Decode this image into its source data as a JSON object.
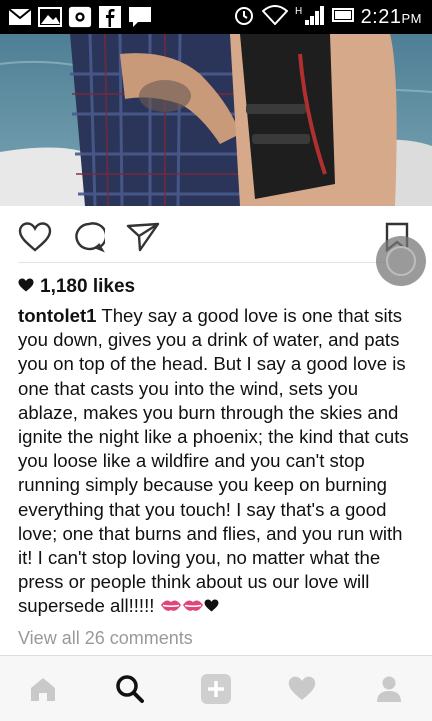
{
  "status_bar": {
    "time": "2:21",
    "ampm": "PM",
    "notification_icons": [
      "mail-icon",
      "gallery-icon",
      "instagram-icon",
      "facebook-icon",
      "message-icon"
    ],
    "system_icons": [
      "alarm-icon",
      "wifi-icon",
      "h-signal-icon",
      "battery-icon"
    ]
  },
  "post": {
    "likes_text": "1,180 likes",
    "username": "tontolet1",
    "caption_text": " They say a good love is one that sits you down, gives you a drink of water, and pats you on top of the head. But I say a good love is one that casts you into the wind, sets you ablaze, makes you burn through the skies and ignite the night like a phoenix; the kind that cuts you loose like a wildfire and you can't stop running simply because you keep on burning everything that you touch! I say that's a good love; one that burns and flies, and you run with it! I can't stop loving you, no matter what the press or people think about us our love will supersede all!!!!! ",
    "caption_emoji": [
      "kiss-mark-icon",
      "kiss-mark-icon",
      "heart-icon"
    ],
    "view_all_comments": "View all 26 comments"
  },
  "actions": [
    "like-icon",
    "comment-icon",
    "share-icon",
    "bookmark-icon"
  ],
  "bottom_nav": [
    "home-icon",
    "search-icon",
    "add-post-icon",
    "activity-icon",
    "profile-icon"
  ],
  "colors": {
    "accent_kiss": "#e0457b",
    "status_bar_bg": "#000000",
    "muted_text": "#999999"
  }
}
